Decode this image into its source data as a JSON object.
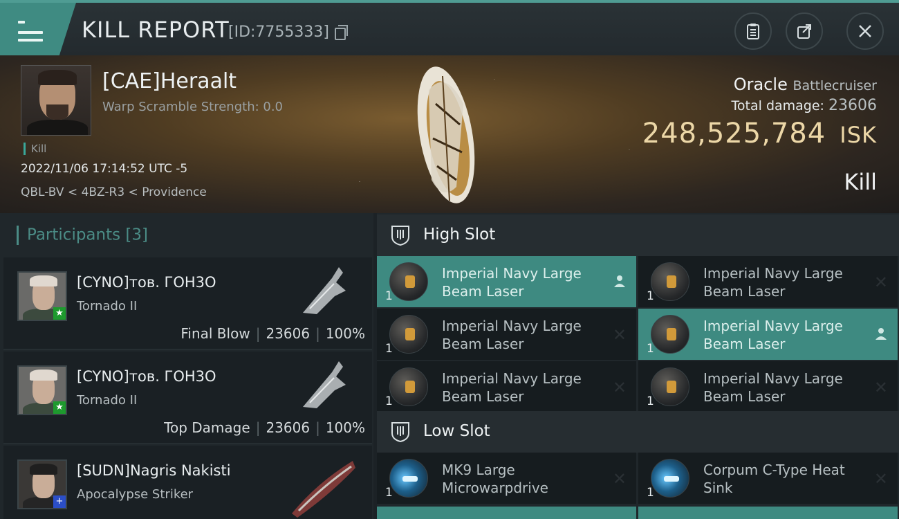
{
  "topbar": {
    "title": "KILL REPORT",
    "report_id": "[ID:7755333]",
    "icons": [
      "menu-icon",
      "copy-icon",
      "clipboard-icon",
      "share-icon",
      "close-icon"
    ]
  },
  "header": {
    "pilot_name": "[CAE]Heraalt",
    "warp_scramble": "Warp Scramble Strength: 0.0",
    "kill_tag": "Kill",
    "datetime": "2022/11/06 17:14:52 UTC -5",
    "location": "QBL-BV < 4BZ-R3 < Providence",
    "ship_name": "Oracle",
    "ship_class": "Battlecruiser",
    "total_damage_label": "Total damage:",
    "total_damage_value": "23606",
    "isk_value": "248,525,784",
    "isk_unit": "ISK",
    "result": "Kill"
  },
  "participants": {
    "label": "Participants",
    "count": "[3]",
    "rows": [
      {
        "name": "[CYNO]тов. ГОН3О",
        "ship": "Tornado II",
        "role": "Final Blow",
        "damage": "23606",
        "percent": "100%"
      },
      {
        "name": "[CYNO]тов. ГОН3О",
        "ship": "Tornado II",
        "role": "Top Damage",
        "damage": "23606",
        "percent": "100%"
      },
      {
        "name": "[SUDN]Nagris Nakisti",
        "ship": "Apocalypse Striker",
        "role": "",
        "damage": "",
        "percent": ""
      }
    ]
  },
  "slots": {
    "high": {
      "label": "High Slot",
      "modules": [
        {
          "name": "Imperial Navy Large Beam Laser",
          "qty": "1",
          "state": "active"
        },
        {
          "name": "Imperial Navy Large Beam Laser",
          "qty": "1",
          "state": "destroyed"
        },
        {
          "name": "Imperial Navy Large Beam Laser",
          "qty": "1",
          "state": "destroyed"
        },
        {
          "name": "Imperial Navy Large Beam Laser",
          "qty": "1",
          "state": "active"
        },
        {
          "name": "Imperial Navy Large Beam Laser",
          "qty": "1",
          "state": "destroyed"
        },
        {
          "name": "Imperial Navy Large Beam Laser",
          "qty": "1",
          "state": "destroyed"
        }
      ]
    },
    "low": {
      "label": "Low Slot",
      "modules": [
        {
          "name": "MK9 Large Microwarpdrive",
          "qty": "1",
          "state": "destroyed"
        },
        {
          "name": "Corpum C-Type Heat Sink",
          "qty": "1",
          "state": "destroyed"
        }
      ]
    }
  },
  "colors": {
    "accent": "#3e8a81",
    "isk": "#ecd7a7",
    "badge_green": "#1e9a2e",
    "badge_blue": "#2b4ec7"
  }
}
